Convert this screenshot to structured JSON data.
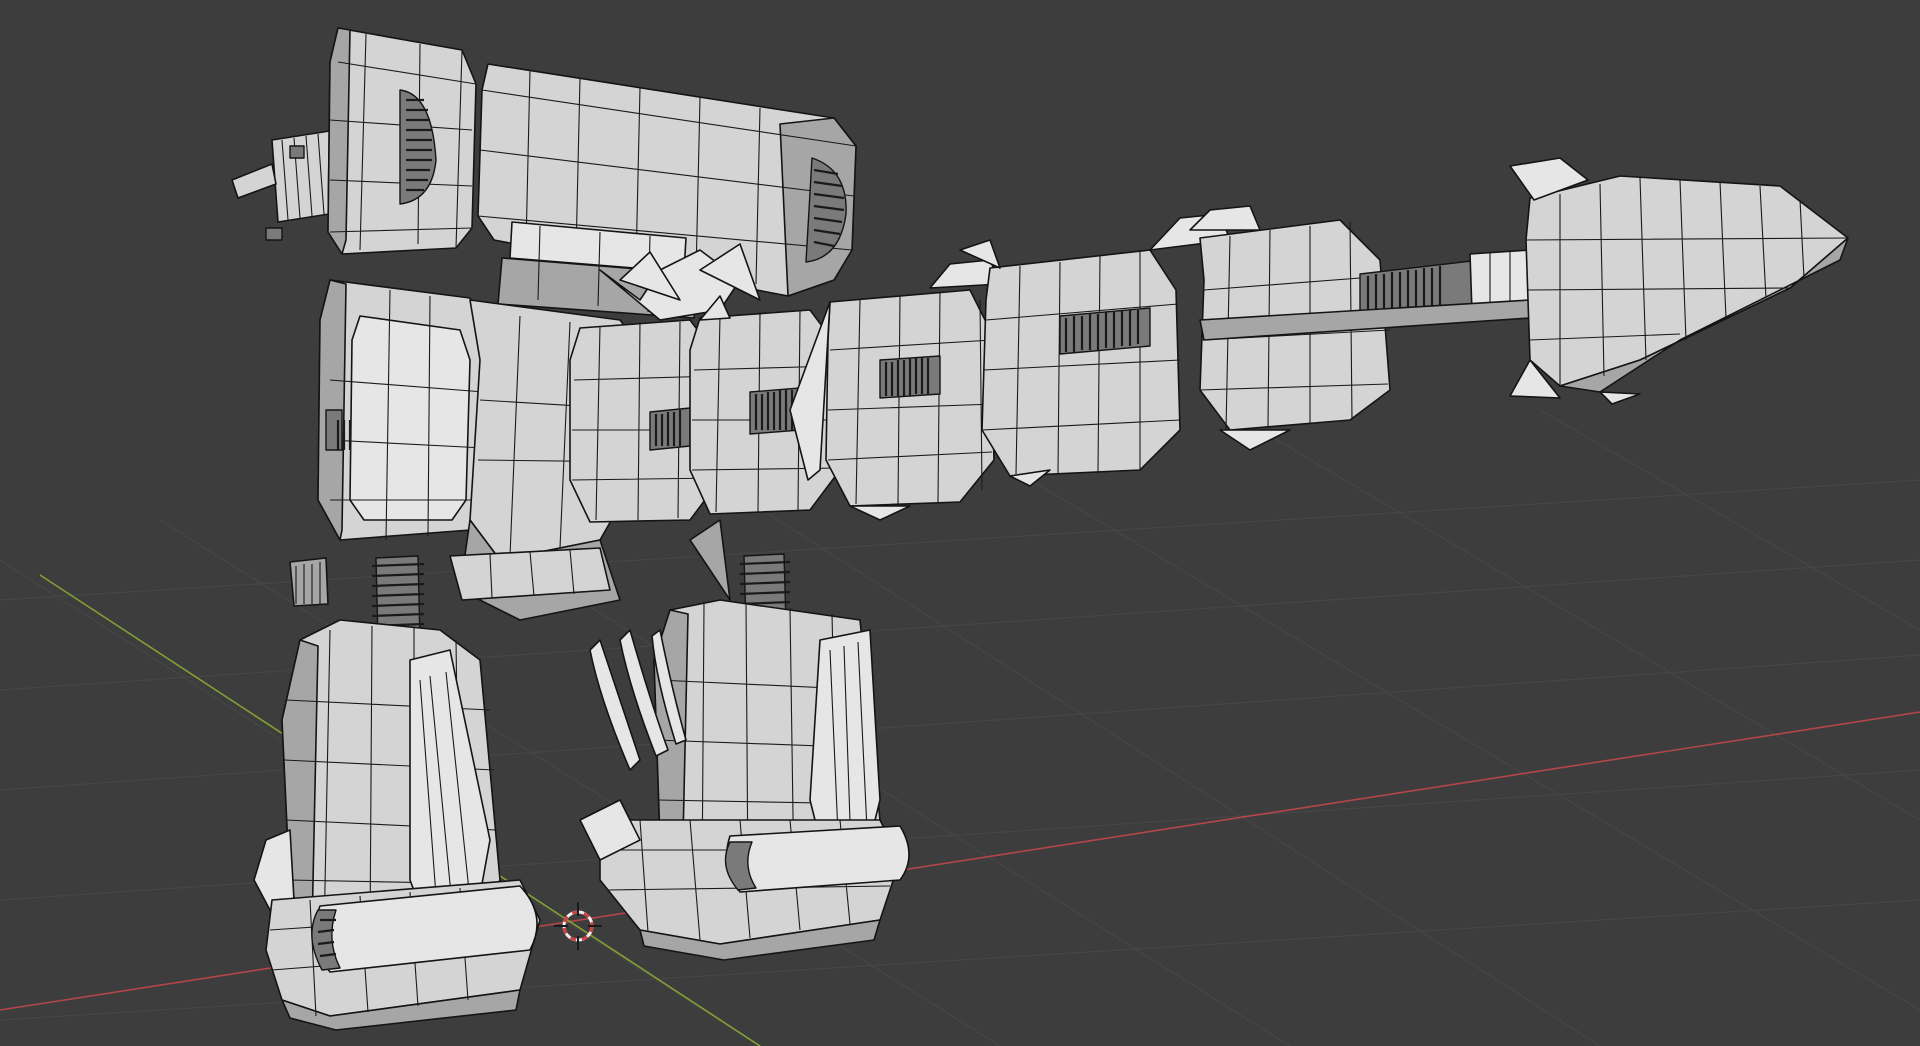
{
  "viewport": {
    "background": "#3d3d3d",
    "grid_color": "#464646",
    "x_axis_color": "#c8484e",
    "y_axis_color": "#8fb034",
    "cursor_color": "#d04040"
  },
  "scene": {
    "object": "mech-model-wireframe",
    "shading": "solid",
    "overlay": "wireframe"
  }
}
